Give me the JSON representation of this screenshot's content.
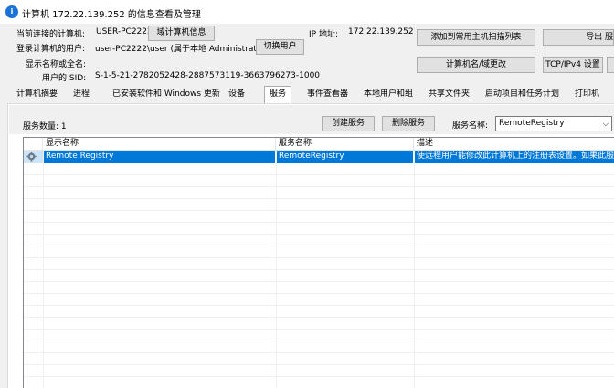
{
  "window": {
    "title": "计算机 172.22.139.252 的信息查看及管理",
    "icon": "app-i-icon"
  },
  "info": {
    "connected_label": "当前连接的计算机:",
    "connected_value": "USER-PC2222",
    "domain_info_button": "域计算机信息",
    "ip_label": "IP 地址:",
    "ip_value": "172.22.139.252",
    "user_label": "登录计算机的用户:",
    "user_value": "user-PC2222\\user (属于本地 Administrators 组)",
    "switch_user_button": "切换用户",
    "display_name_label": "显示名称或全名:",
    "display_name_value": "",
    "sid_label": "用户的 SID:",
    "sid_value": "S-1-5-21-2782052428-2887573119-3663796273-1000"
  },
  "right_buttons": {
    "add_to_scan_list": "添加到常用主机扫描列表",
    "export": "导出 服",
    "rename": "计算机名/域更改",
    "tcp_ipv4": "TCP/IPv4 设置"
  },
  "tabs": [
    "计算机摘要",
    "进程",
    "已安装软件和 Windows 更新",
    "设备",
    "服务",
    "事件查看器",
    "本地用户和组",
    "共享文件夹",
    "启动项目和任务计划",
    "打印机"
  ],
  "active_tab": "服务",
  "services": {
    "count_label": "服务数量: 1",
    "create_button": "创建服务",
    "delete_button": "删除服务",
    "name_label": "服务名称:",
    "name_select_value": "RemoteRegistry",
    "columns": [
      "显示名称",
      "服务名称",
      "描述"
    ],
    "rows": [
      {
        "display_name": "Remote Registry",
        "service_name": "RemoteRegistry",
        "description": "使远程用户能修改此计算机上的注册表设置。如果此服"
      }
    ]
  },
  "colors": {
    "selection": "#0078d7",
    "window_bg": "#f0f0f0",
    "button_bg": "#e1e1e1"
  }
}
